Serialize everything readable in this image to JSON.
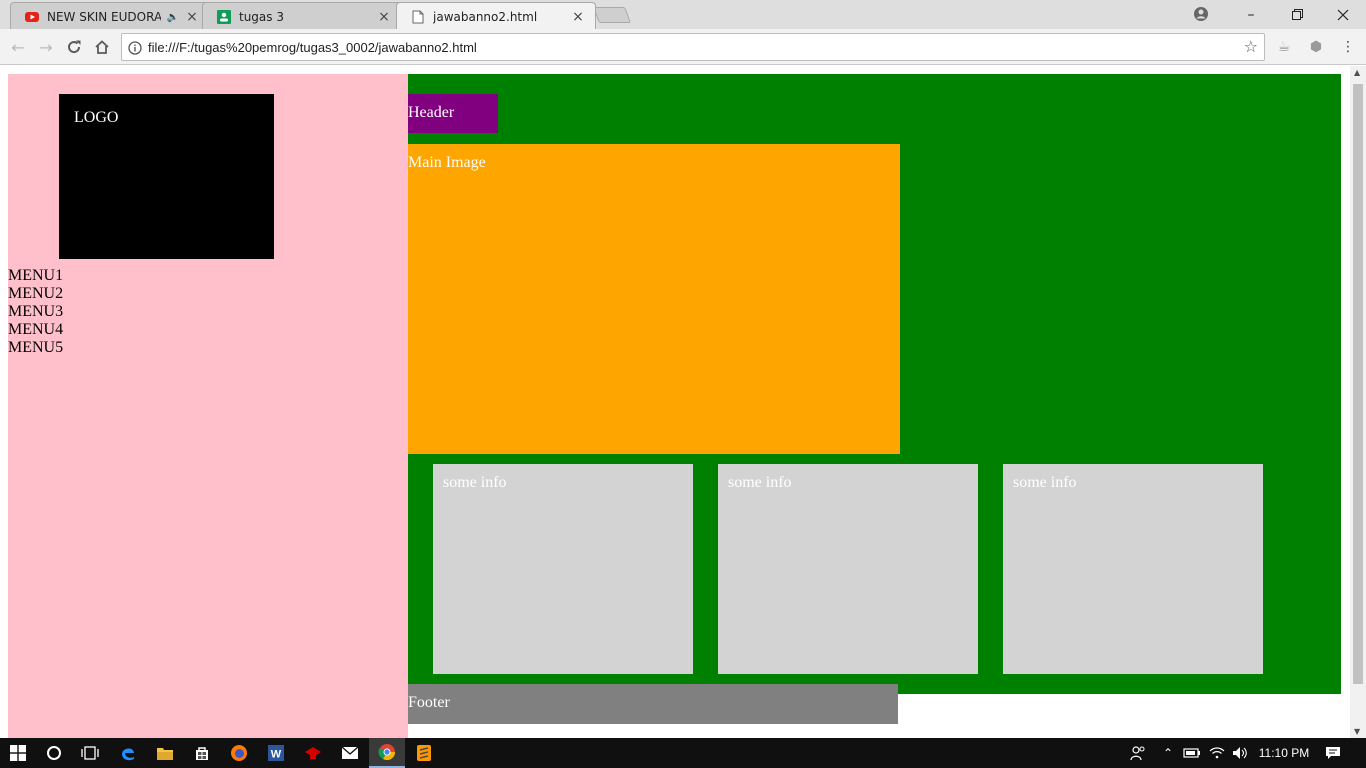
{
  "browser": {
    "tabs": [
      {
        "title": "NEW SKIN EUDORA L",
        "favicon": "youtube-icon",
        "audio": true
      },
      {
        "title": "tugas 3",
        "favicon": "classroom-icon",
        "audio": false
      },
      {
        "title": "jawabanno2.html",
        "favicon": "page-icon",
        "audio": false,
        "active": true
      }
    ],
    "url": "file:///F:/tugas%20pemrog/tugas3_0002/jawabanno2.html"
  },
  "page": {
    "logo": "LOGO",
    "menu": [
      "MENU1",
      "MENU2",
      "MENU3",
      "MENU4",
      "MENU5"
    ],
    "header": "Header",
    "main_image": "Main Image",
    "info": [
      "some info",
      "some info",
      "some info"
    ],
    "footer": "Footer"
  },
  "colors": {
    "sidebar": "#ffc0cb",
    "content": "#008000",
    "header": "#800080",
    "main_image": "#ffa500",
    "info": "#d3d3d3",
    "footer": "#808080",
    "logo": "#000000"
  },
  "taskbar": {
    "clock": "11:10 PM",
    "apps": [
      "windows-start-icon",
      "cortana-icon",
      "task-view-icon",
      "edge-icon",
      "file-explorer-icon",
      "store-icon",
      "firefox-icon",
      "word-icon",
      "app-icon",
      "mail-icon",
      "chrome-icon",
      "sublime-icon"
    ]
  }
}
